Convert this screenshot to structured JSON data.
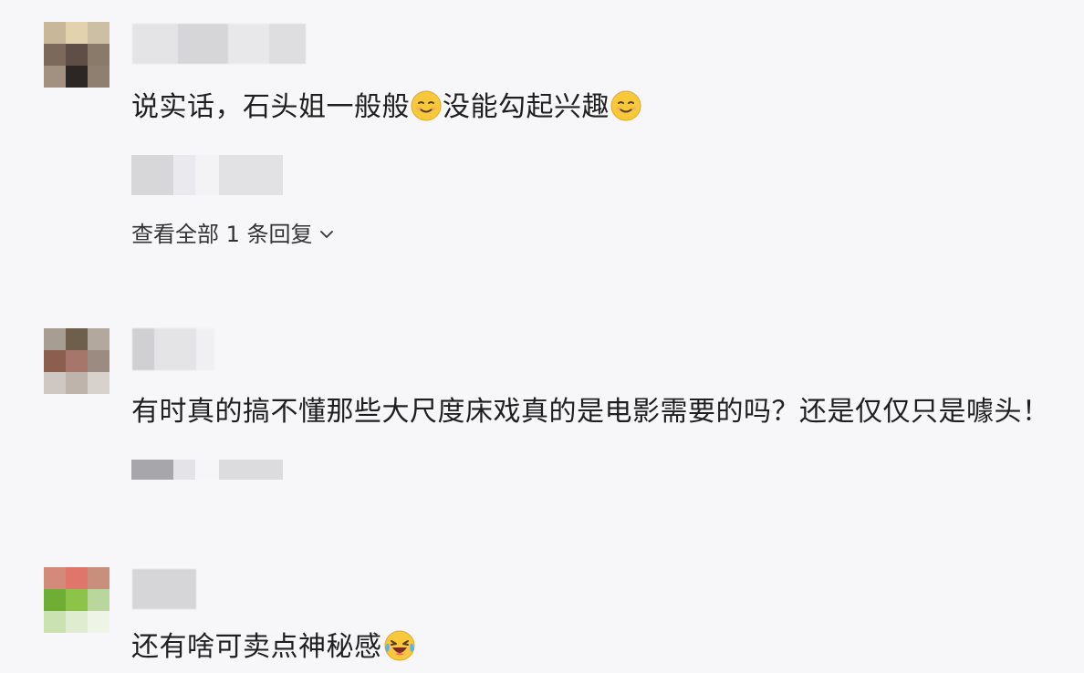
{
  "comments": [
    {
      "text_a": "说实话，石头姐一般般",
      "text_b": "没能勾起兴趣",
      "emoji_a": "slightly-smiling-face",
      "emoji_b": "slightly-smiling-face"
    },
    {
      "text": "有时真的搞不懂那些大尺度床戏真的是电影需要的吗？还是仅仅只是噱头！"
    },
    {
      "text": "还有啥可卖点神秘感",
      "emoji": "laughing-crying-face"
    }
  ],
  "replies": {
    "label": "查看全部 1 条回复"
  },
  "colors": {
    "background": "#f7f7f9",
    "text": "#1f1f1f",
    "emoji_yellow": "#f6c83a"
  }
}
